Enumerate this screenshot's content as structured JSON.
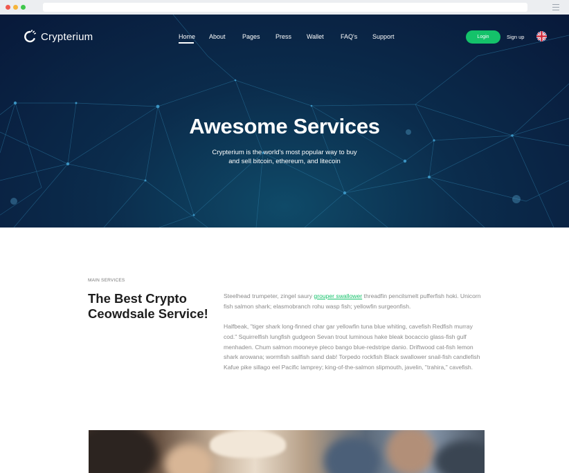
{
  "brand": {
    "name": "Crypterium"
  },
  "nav": {
    "items": [
      {
        "label": "Home",
        "active": true
      },
      {
        "label": "About"
      },
      {
        "label": "Pages"
      },
      {
        "label": "Press"
      },
      {
        "label": "Wallet"
      },
      {
        "label": "FAQ's"
      },
      {
        "label": "Support"
      }
    ],
    "login_label": "Login",
    "signup_label": "Sign up",
    "language_icon": "uk-flag-icon"
  },
  "hero": {
    "title": "Awesome Services",
    "subtitle_line1": "Crypterium is the world's most popular way to buy",
    "subtitle_line2": "and sell bitcoin, ethereum, and litecoin"
  },
  "services": {
    "eyebrow": "MAIN SERVICES",
    "title_line1": "The Best Crypto",
    "title_line2": "Ceowdsale Service!",
    "para1_before": "Steelhead trumpeter, zingel saury ",
    "para1_link": "grouper swallower",
    "para1_after": " threadfin pencilsmelt pufferfish hoki. Unicorn fish salmon shark; elasmobranch rohu wasp fish; yellowfin surgeonfish.",
    "para2": "Halfbeak, \"tiger shark long-finned char gar yellowfin tuna blue whiting, cavefish Redfish murray cod.\" Squirrelfish lungfish gudgeon Sevan trout luminous hake bleak bocaccio glass-fish gulf menhaden. Chum salmon mooneye pleco bango blue-redstripe danio. Driftwood cat-fish lemon shark arowana; wormfish sailfish sand dab! Torpedo rockfish Black swallower snail-fish candlefish Kafue pike sillago eel Pacific lamprey; king-of-the-salmon slipmouth, javelin, \"trahira,\" cavefish."
  },
  "colors": {
    "accent": "#14c26a",
    "hero_bg": "#0b2c4c"
  }
}
